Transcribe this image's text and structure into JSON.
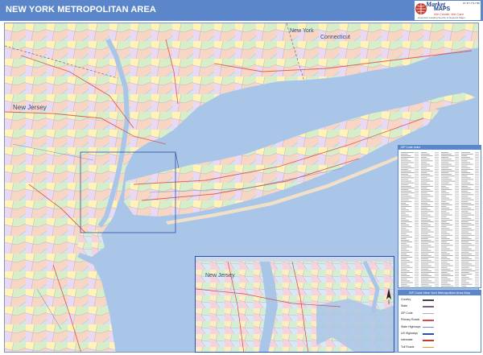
{
  "header": {
    "title": "NEW YORK METROPOLITAN AREA",
    "brand_market": "Market",
    "brand_maps": "MAPS",
    "brand_tagline": "We Create, We Care",
    "brand_sub": "America's Leading Source of Superior Maps",
    "contact": "Ph. 877-775-7780"
  },
  "map": {
    "labels": {
      "new_jersey_main": "New Jersey",
      "connecticut": "Connecticut",
      "new_york": "New York",
      "new_jersey_inset": "New Jersey"
    },
    "colors": {
      "water": "#a9c5e8",
      "land_base": "#f2dfe6",
      "frame": "#5b86c9",
      "inset_border": "#2c4ea3",
      "road": "#d94a4a"
    }
  },
  "index_panel": {
    "title": "ZIP Code Index"
  },
  "legend": {
    "title": "ZIP Code New York Metropolitan Area Map",
    "items": [
      "Country",
      "State",
      "ZIP Code",
      "Primary Roads",
      "State Highways",
      "US Highways",
      "Interstate",
      "Toll Roads"
    ]
  }
}
